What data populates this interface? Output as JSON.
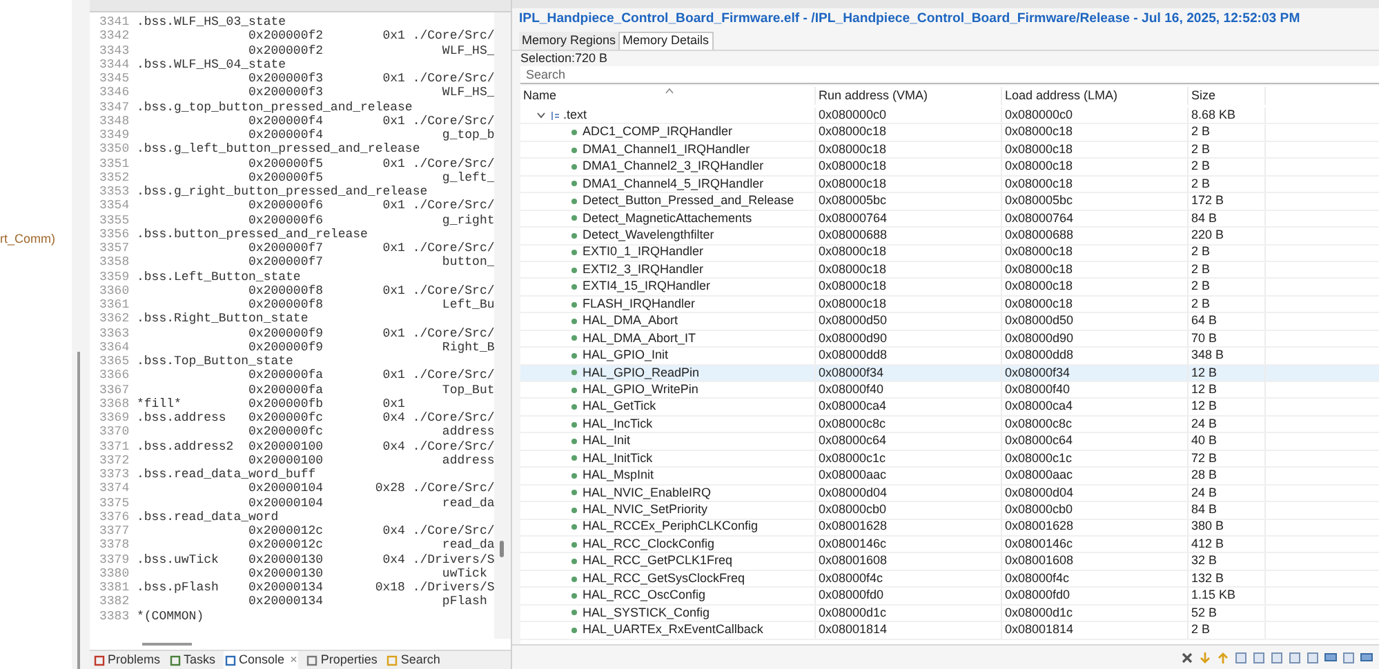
{
  "left_panel": {
    "fragment": "rt_Comm)"
  },
  "editor": {
    "lines": [
      {
        "number": "3341",
        "text": ".bss.WLF_HS_03_state"
      },
      {
        "number": "3342",
        "text": "               0x200000f2        0x1 ./Core/Src/"
      },
      {
        "number": "3343",
        "text": "               0x200000f2                WLF_HS_"
      },
      {
        "number": "3344",
        "text": ".bss.WLF_HS_04_state"
      },
      {
        "number": "3345",
        "text": "               0x200000f3        0x1 ./Core/Src/"
      },
      {
        "number": "3346",
        "text": "               0x200000f3                WLF_HS_"
      },
      {
        "number": "3347",
        "text": ".bss.g_top_button_pressed_and_release"
      },
      {
        "number": "3348",
        "text": "               0x200000f4        0x1 ./Core/Src/"
      },
      {
        "number": "3349",
        "text": "               0x200000f4                g_top_b"
      },
      {
        "number": "3350",
        "text": ".bss.g_left_button_pressed_and_release"
      },
      {
        "number": "3351",
        "text": "               0x200000f5        0x1 ./Core/Src/"
      },
      {
        "number": "3352",
        "text": "               0x200000f5                g_left_"
      },
      {
        "number": "3353",
        "text": ".bss.g_right_button_pressed_and_release"
      },
      {
        "number": "3354",
        "text": "               0x200000f6        0x1 ./Core/Src/"
      },
      {
        "number": "3355",
        "text": "               0x200000f6                g_right"
      },
      {
        "number": "3356",
        "text": ".bss.button_pressed_and_release"
      },
      {
        "number": "3357",
        "text": "               0x200000f7        0x1 ./Core/Src/"
      },
      {
        "number": "3358",
        "text": "               0x200000f7                button_"
      },
      {
        "number": "3359",
        "text": ".bss.Left_Button_state"
      },
      {
        "number": "3360",
        "text": "               0x200000f8        0x1 ./Core/Src/"
      },
      {
        "number": "3361",
        "text": "               0x200000f8                Left_Bu"
      },
      {
        "number": "3362",
        "text": ".bss.Right_Button_state"
      },
      {
        "number": "3363",
        "text": "               0x200000f9        0x1 ./Core/Src/"
      },
      {
        "number": "3364",
        "text": "               0x200000f9                Right_B"
      },
      {
        "number": "3365",
        "text": ".bss.Top_Button_state"
      },
      {
        "number": "3366",
        "text": "               0x200000fa        0x1 ./Core/Src/"
      },
      {
        "number": "3367",
        "text": "               0x200000fa                Top_But"
      },
      {
        "number": "3368",
        "text": "*fill*         0x200000fb        0x1"
      },
      {
        "number": "3369",
        "text": ".bss.address   0x200000fc        0x4 ./Core/Src/"
      },
      {
        "number": "3370",
        "text": "               0x200000fc                address"
      },
      {
        "number": "3371",
        "text": ".bss.address2  0x20000100        0x4 ./Core/Src/"
      },
      {
        "number": "3372",
        "text": "               0x20000100                address"
      },
      {
        "number": "3373",
        "text": ".bss.read_data_word_buff"
      },
      {
        "number": "3374",
        "text": "               0x20000104       0x28 ./Core/Src/"
      },
      {
        "number": "3375",
        "text": "               0x20000104                read_da"
      },
      {
        "number": "3376",
        "text": ".bss.read_data_word"
      },
      {
        "number": "3377",
        "text": "               0x2000012c        0x4 ./Core/Src/"
      },
      {
        "number": "3378",
        "text": "               0x2000012c                read_da"
      },
      {
        "number": "3379",
        "text": ".bss.uwTick    0x20000130        0x4 ./Drivers/S"
      },
      {
        "number": "3380",
        "text": "               0x20000130                uwTick"
      },
      {
        "number": "3381",
        "text": ".bss.pFlash    0x20000134       0x18 ./Drivers/S"
      },
      {
        "number": "3382",
        "text": "               0x20000134                pFlash"
      },
      {
        "number": "3383",
        "text": "*(COMMON)"
      }
    ]
  },
  "bottom_tabs": [
    {
      "label": "Problems",
      "selected": false
    },
    {
      "label": "Tasks",
      "selected": false
    },
    {
      "label": "Console",
      "selected": true,
      "close": "×"
    },
    {
      "label": "Properties",
      "selected": false
    },
    {
      "label": "Search",
      "selected": false
    }
  ],
  "build_analyzer": {
    "title": "IPL_Handpiece_Control_Board_Firmware.elf - /IPL_Handpiece_Control_Board_Firmware/Release - Jul 16, 2025, 12:52:03 PM",
    "tabs": [
      {
        "label": "Memory Regions",
        "selected": false
      },
      {
        "label": "Memory Details",
        "selected": true
      }
    ],
    "selection": "Selection:720 B",
    "search": {
      "placeholder": "Search"
    },
    "table": {
      "columns": [
        "Name",
        "Run address (VMA)",
        "Load address (LMA)",
        "Size"
      ],
      "rows": [
        {
          "name": ".text",
          "vma": "0x080000c0",
          "lma": "0x080000c0",
          "size": "8.68 KB",
          "expanded": true,
          "selected": false,
          "children": [
            {
              "name": "ADC1_COMP_IRQHandler",
              "vma": "0x08000c18",
              "lma": "0x08000c18",
              "size": "2 B",
              "selected": false
            },
            {
              "name": "DMA1_Channel1_IRQHandler",
              "vma": "0x08000c18",
              "lma": "0x08000c18",
              "size": "2 B",
              "selected": false
            },
            {
              "name": "DMA1_Channel2_3_IRQHandler",
              "vma": "0x08000c18",
              "lma": "0x08000c18",
              "size": "2 B",
              "selected": false
            },
            {
              "name": "DMA1_Channel4_5_IRQHandler",
              "vma": "0x08000c18",
              "lma": "0x08000c18",
              "size": "2 B",
              "selected": false
            },
            {
              "name": "Detect_Button_Pressed_and_Release",
              "vma": "0x080005bc",
              "lma": "0x080005bc",
              "size": "172 B",
              "selected": false
            },
            {
              "name": "Detect_MagneticAttachements",
              "vma": "0x08000764",
              "lma": "0x08000764",
              "size": "84 B",
              "selected": false
            },
            {
              "name": "Detect_Wavelengthfilter",
              "vma": "0x08000688",
              "lma": "0x08000688",
              "size": "220 B",
              "selected": false
            },
            {
              "name": "EXTI0_1_IRQHandler",
              "vma": "0x08000c18",
              "lma": "0x08000c18",
              "size": "2 B",
              "selected": false
            },
            {
              "name": "EXTI2_3_IRQHandler",
              "vma": "0x08000c18",
              "lma": "0x08000c18",
              "size": "2 B",
              "selected": false
            },
            {
              "name": "EXTI4_15_IRQHandler",
              "vma": "0x08000c18",
              "lma": "0x08000c18",
              "size": "2 B",
              "selected": false
            },
            {
              "name": "FLASH_IRQHandler",
              "vma": "0x08000c18",
              "lma": "0x08000c18",
              "size": "2 B",
              "selected": false
            },
            {
              "name": "HAL_DMA_Abort",
              "vma": "0x08000d50",
              "lma": "0x08000d50",
              "size": "64 B",
              "selected": false
            },
            {
              "name": "HAL_DMA_Abort_IT",
              "vma": "0x08000d90",
              "lma": "0x08000d90",
              "size": "70 B",
              "selected": false
            },
            {
              "name": "HAL_GPIO_Init",
              "vma": "0x08000dd8",
              "lma": "0x08000dd8",
              "size": "348 B",
              "selected": false
            },
            {
              "name": "HAL_GPIO_ReadPin",
              "vma": "0x08000f34",
              "lma": "0x08000f34",
              "size": "12 B",
              "selected": true
            },
            {
              "name": "HAL_GPIO_WritePin",
              "vma": "0x08000f40",
              "lma": "0x08000f40",
              "size": "12 B",
              "selected": false
            },
            {
              "name": "HAL_GetTick",
              "vma": "0x08000ca4",
              "lma": "0x08000ca4",
              "size": "12 B",
              "selected": false
            },
            {
              "name": "HAL_IncTick",
              "vma": "0x08000c8c",
              "lma": "0x08000c8c",
              "size": "24 B",
              "selected": false
            },
            {
              "name": "HAL_Init",
              "vma": "0x08000c64",
              "lma": "0x08000c64",
              "size": "40 B",
              "selected": false
            },
            {
              "name": "HAL_InitTick",
              "vma": "0x08000c1c",
              "lma": "0x08000c1c",
              "size": "72 B",
              "selected": false
            },
            {
              "name": "HAL_MspInit",
              "vma": "0x08000aac",
              "lma": "0x08000aac",
              "size": "28 B",
              "selected": false
            },
            {
              "name": "HAL_NVIC_EnableIRQ",
              "vma": "0x08000d04",
              "lma": "0x08000d04",
              "size": "24 B",
              "selected": false
            },
            {
              "name": "HAL_NVIC_SetPriority",
              "vma": "0x08000cb0",
              "lma": "0x08000cb0",
              "size": "84 B",
              "selected": false
            },
            {
              "name": "HAL_RCCEx_PeriphCLKConfig",
              "vma": "0x08001628",
              "lma": "0x08001628",
              "size": "380 B",
              "selected": false
            },
            {
              "name": "HAL_RCC_ClockConfig",
              "vma": "0x0800146c",
              "lma": "0x0800146c",
              "size": "412 B",
              "selected": false
            },
            {
              "name": "HAL_RCC_GetPCLK1Freq",
              "vma": "0x08001608",
              "lma": "0x08001608",
              "size": "32 B",
              "selected": false
            },
            {
              "name": "HAL_RCC_GetSysClockFreq",
              "vma": "0x08000f4c",
              "lma": "0x08000f4c",
              "size": "132 B",
              "selected": false
            },
            {
              "name": "HAL_RCC_OscConfig",
              "vma": "0x08000fd0",
              "lma": "0x08000fd0",
              "size": "1.15 KB",
              "selected": false
            },
            {
              "name": "HAL_SYSTICK_Config",
              "vma": "0x08000d1c",
              "lma": "0x08000d1c",
              "size": "52 B",
              "selected": false
            },
            {
              "name": "HAL_UARTEx_RxEventCallback",
              "vma": "0x08001814",
              "lma": "0x08001814",
              "size": "2 B",
              "selected": false
            }
          ]
        }
      ]
    }
  }
}
